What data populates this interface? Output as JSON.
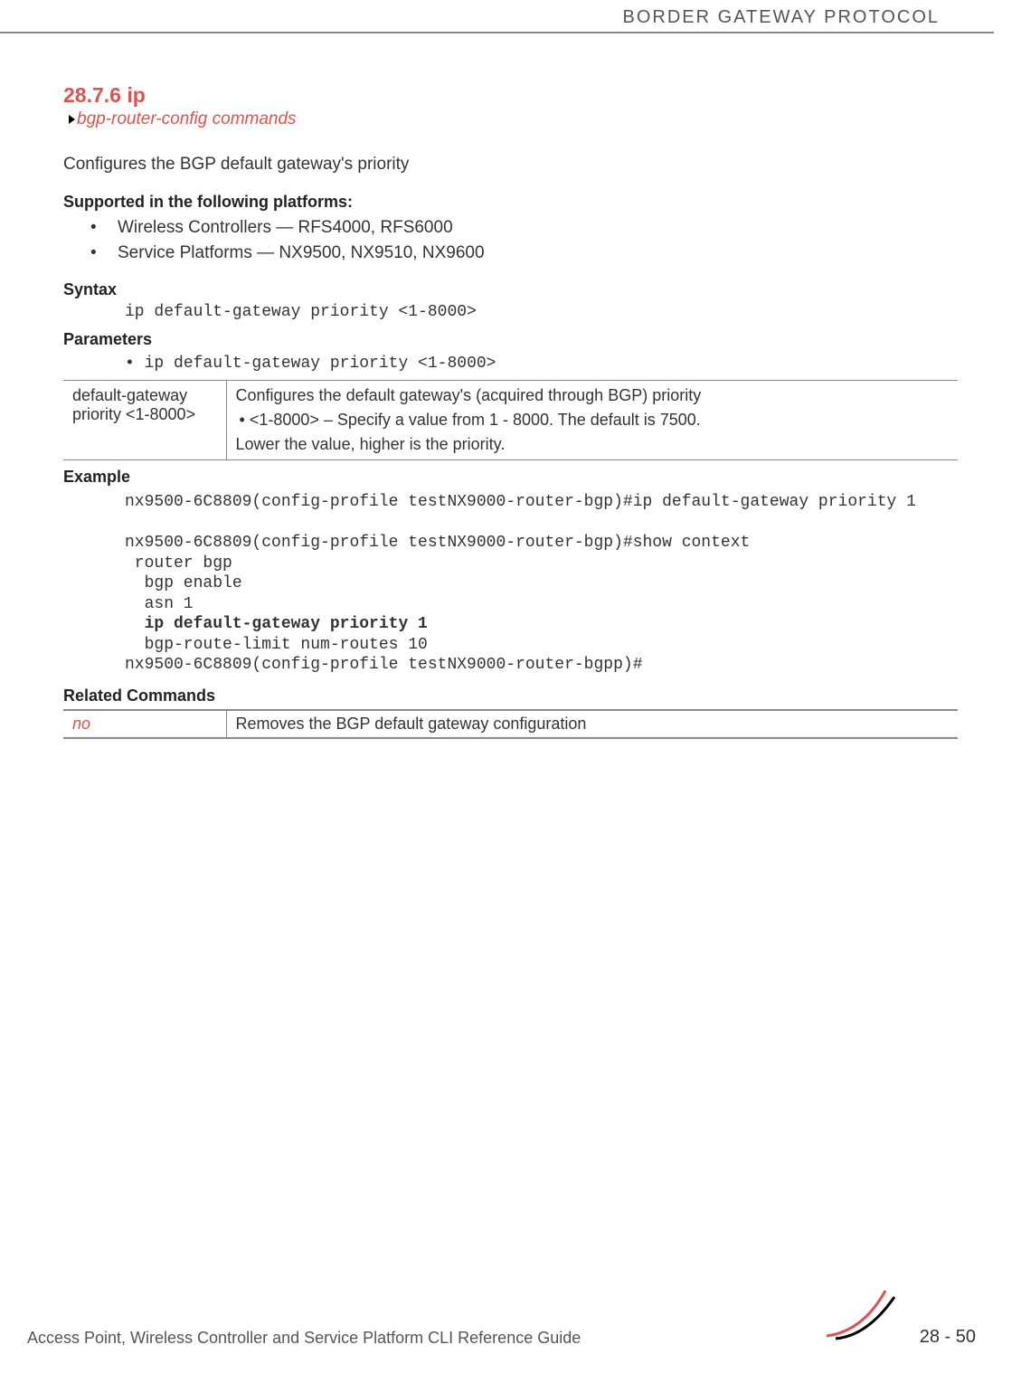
{
  "header": {
    "title": "BORDER GATEWAY PROTOCOL"
  },
  "section": {
    "number_title": "28.7.6 ip",
    "breadcrumb": "bgp-router-config commands",
    "description": "Configures the BGP default gateway's priority"
  },
  "supported": {
    "heading": "Supported in the following platforms:",
    "items": [
      "Wireless Controllers — RFS4000, RFS6000",
      "Service Platforms — NX9500, NX9510, NX9600"
    ]
  },
  "syntax": {
    "heading": "Syntax",
    "code": "ip default-gateway priority <1-8000>"
  },
  "parameters": {
    "heading": "Parameters",
    "code": "ip default-gateway priority <1-8000>",
    "table": {
      "left": "default-gateway priority <1-8000>",
      "right_line1": "Configures the default gateway's (acquired through BGP) priority",
      "right_bullet": "<1-8000> – Specify a value from 1 - 8000. The default is 7500.",
      "right_line2": "Lower the value, higher is the priority."
    }
  },
  "example": {
    "heading": "Example",
    "lines": {
      "l1": "nx9500-6C8809(config-profile testNX9000-router-bgp)#ip default-gateway priority 1",
      "l2": "",
      "l3": "nx9500-6C8809(config-profile testNX9000-router-bgp)#show context",
      "l4": " router bgp",
      "l5": "  bgp enable",
      "l6": "  asn 1",
      "l7": "  ip default-gateway priority 1",
      "l8": "  bgp-route-limit num-routes 10",
      "l9": "nx9500-6C8809(config-profile testNX9000-router-bgpp)#"
    }
  },
  "related": {
    "heading": "Related Commands",
    "table": {
      "left": "no",
      "right": "Removes the BGP default gateway configuration"
    }
  },
  "footer": {
    "guide": "Access Point, Wireless Controller and Service Platform CLI Reference Guide",
    "page": "28 - 50"
  }
}
